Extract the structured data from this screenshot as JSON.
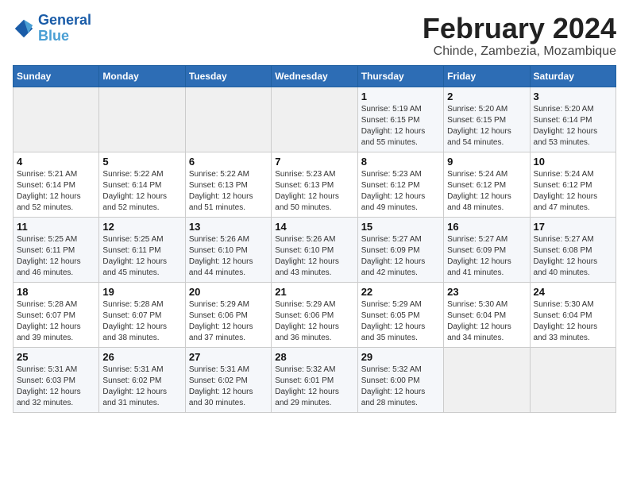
{
  "logo": {
    "line1": "General",
    "line2": "Blue"
  },
  "title": "February 2024",
  "subtitle": "Chinde, Zambezia, Mozambique",
  "weekdays": [
    "Sunday",
    "Monday",
    "Tuesday",
    "Wednesday",
    "Thursday",
    "Friday",
    "Saturday"
  ],
  "weeks": [
    [
      {
        "num": "",
        "info": ""
      },
      {
        "num": "",
        "info": ""
      },
      {
        "num": "",
        "info": ""
      },
      {
        "num": "",
        "info": ""
      },
      {
        "num": "1",
        "info": "Sunrise: 5:19 AM\nSunset: 6:15 PM\nDaylight: 12 hours\nand 55 minutes."
      },
      {
        "num": "2",
        "info": "Sunrise: 5:20 AM\nSunset: 6:15 PM\nDaylight: 12 hours\nand 54 minutes."
      },
      {
        "num": "3",
        "info": "Sunrise: 5:20 AM\nSunset: 6:14 PM\nDaylight: 12 hours\nand 53 minutes."
      }
    ],
    [
      {
        "num": "4",
        "info": "Sunrise: 5:21 AM\nSunset: 6:14 PM\nDaylight: 12 hours\nand 52 minutes."
      },
      {
        "num": "5",
        "info": "Sunrise: 5:22 AM\nSunset: 6:14 PM\nDaylight: 12 hours\nand 52 minutes."
      },
      {
        "num": "6",
        "info": "Sunrise: 5:22 AM\nSunset: 6:13 PM\nDaylight: 12 hours\nand 51 minutes."
      },
      {
        "num": "7",
        "info": "Sunrise: 5:23 AM\nSunset: 6:13 PM\nDaylight: 12 hours\nand 50 minutes."
      },
      {
        "num": "8",
        "info": "Sunrise: 5:23 AM\nSunset: 6:12 PM\nDaylight: 12 hours\nand 49 minutes."
      },
      {
        "num": "9",
        "info": "Sunrise: 5:24 AM\nSunset: 6:12 PM\nDaylight: 12 hours\nand 48 minutes."
      },
      {
        "num": "10",
        "info": "Sunrise: 5:24 AM\nSunset: 6:12 PM\nDaylight: 12 hours\nand 47 minutes."
      }
    ],
    [
      {
        "num": "11",
        "info": "Sunrise: 5:25 AM\nSunset: 6:11 PM\nDaylight: 12 hours\nand 46 minutes."
      },
      {
        "num": "12",
        "info": "Sunrise: 5:25 AM\nSunset: 6:11 PM\nDaylight: 12 hours\nand 45 minutes."
      },
      {
        "num": "13",
        "info": "Sunrise: 5:26 AM\nSunset: 6:10 PM\nDaylight: 12 hours\nand 44 minutes."
      },
      {
        "num": "14",
        "info": "Sunrise: 5:26 AM\nSunset: 6:10 PM\nDaylight: 12 hours\nand 43 minutes."
      },
      {
        "num": "15",
        "info": "Sunrise: 5:27 AM\nSunset: 6:09 PM\nDaylight: 12 hours\nand 42 minutes."
      },
      {
        "num": "16",
        "info": "Sunrise: 5:27 AM\nSunset: 6:09 PM\nDaylight: 12 hours\nand 41 minutes."
      },
      {
        "num": "17",
        "info": "Sunrise: 5:27 AM\nSunset: 6:08 PM\nDaylight: 12 hours\nand 40 minutes."
      }
    ],
    [
      {
        "num": "18",
        "info": "Sunrise: 5:28 AM\nSunset: 6:07 PM\nDaylight: 12 hours\nand 39 minutes."
      },
      {
        "num": "19",
        "info": "Sunrise: 5:28 AM\nSunset: 6:07 PM\nDaylight: 12 hours\nand 38 minutes."
      },
      {
        "num": "20",
        "info": "Sunrise: 5:29 AM\nSunset: 6:06 PM\nDaylight: 12 hours\nand 37 minutes."
      },
      {
        "num": "21",
        "info": "Sunrise: 5:29 AM\nSunset: 6:06 PM\nDaylight: 12 hours\nand 36 minutes."
      },
      {
        "num": "22",
        "info": "Sunrise: 5:29 AM\nSunset: 6:05 PM\nDaylight: 12 hours\nand 35 minutes."
      },
      {
        "num": "23",
        "info": "Sunrise: 5:30 AM\nSunset: 6:04 PM\nDaylight: 12 hours\nand 34 minutes."
      },
      {
        "num": "24",
        "info": "Sunrise: 5:30 AM\nSunset: 6:04 PM\nDaylight: 12 hours\nand 33 minutes."
      }
    ],
    [
      {
        "num": "25",
        "info": "Sunrise: 5:31 AM\nSunset: 6:03 PM\nDaylight: 12 hours\nand 32 minutes."
      },
      {
        "num": "26",
        "info": "Sunrise: 5:31 AM\nSunset: 6:02 PM\nDaylight: 12 hours\nand 31 minutes."
      },
      {
        "num": "27",
        "info": "Sunrise: 5:31 AM\nSunset: 6:02 PM\nDaylight: 12 hours\nand 30 minutes."
      },
      {
        "num": "28",
        "info": "Sunrise: 5:32 AM\nSunset: 6:01 PM\nDaylight: 12 hours\nand 29 minutes."
      },
      {
        "num": "29",
        "info": "Sunrise: 5:32 AM\nSunset: 6:00 PM\nDaylight: 12 hours\nand 28 minutes."
      },
      {
        "num": "",
        "info": ""
      },
      {
        "num": "",
        "info": ""
      }
    ]
  ]
}
